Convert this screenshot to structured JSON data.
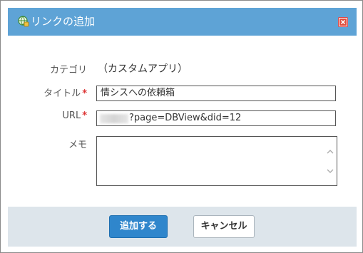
{
  "dialog": {
    "title": "リンクの追加",
    "title_icon": "globe-link-icon",
    "close_icon": "close-icon"
  },
  "form": {
    "category": {
      "label": "カテゴリ",
      "value": "（カスタムアプリ）"
    },
    "title_field": {
      "label": "タイトル",
      "required_mark": "*",
      "value": "情シスへの依頼箱"
    },
    "url_field": {
      "label": "URL",
      "required_mark": "*",
      "value": "?page=DBView&did=12"
    },
    "memo_field": {
      "label": "メモ",
      "value": ""
    }
  },
  "footer": {
    "add_label": "追加する",
    "cancel_label": "キャンセル"
  },
  "colors": {
    "titlebar": "#5ea3d6",
    "primary_button": "#2f86cc",
    "footer_bg": "#dde5eb",
    "required": "#d33333"
  }
}
